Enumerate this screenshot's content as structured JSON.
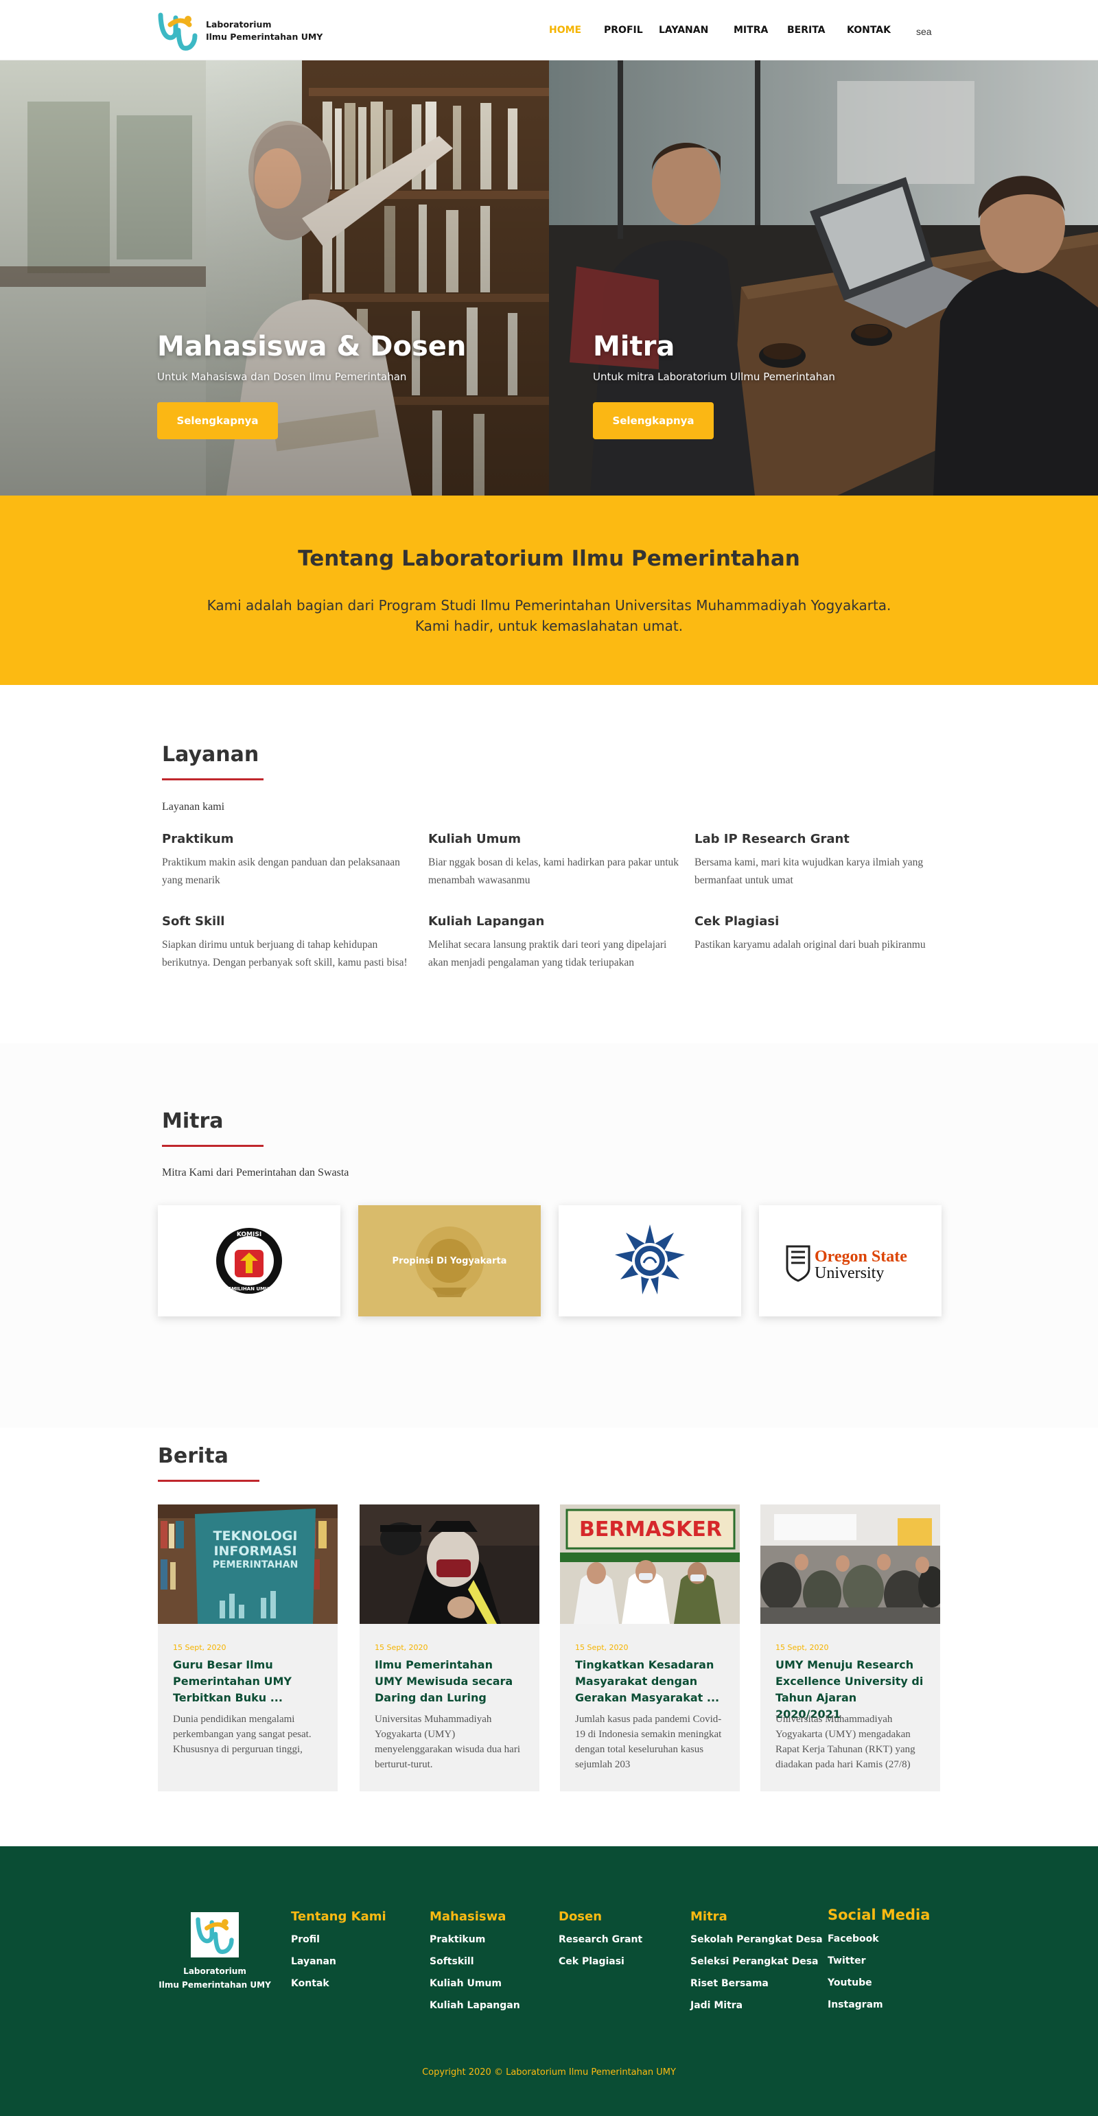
{
  "brand": {
    "name_line1": "Laboratorium",
    "name_line2": "Ilmu Pemerintahan UMY",
    "colors": {
      "primary_yellow": "#fcba12",
      "dark_green": "#0a4d34",
      "accent_red": "#c0272d",
      "teal": "#3cb8c4"
    }
  },
  "nav": {
    "items": [
      {
        "label": "HOME",
        "active": true
      },
      {
        "label": "PROFIL"
      },
      {
        "label": "LAYANAN"
      },
      {
        "label": "MITRA"
      },
      {
        "label": "BERITA"
      },
      {
        "label": "KONTAK"
      }
    ],
    "search_text": "sea"
  },
  "hero": {
    "left": {
      "title": "Mahasiswa & Dosen",
      "subtitle": "Untuk Mahasiswa dan Dosen Ilmu Pemerintahan",
      "button": "Selengkapnya"
    },
    "right": {
      "title": "Mitra",
      "subtitle": "Untuk mitra Laboratorium Ullmu Pemerintahan",
      "button": "Selengkapnya"
    }
  },
  "about": {
    "title": "Tentang Laboratorium Ilmu Pemerintahan",
    "line1": "Kami adalah bagian dari Program Studi Ilmu Pemerintahan Universitas Muhammadiyah Yogyakarta.",
    "line2": "Kami hadir, untuk kemaslahatan umat."
  },
  "layanan": {
    "title": "Layanan",
    "subtitle": "Layanan kami",
    "items": [
      {
        "title": "Praktikum",
        "desc": "Praktikum makin asik dengan panduan dan pelaksanaan yang menarik"
      },
      {
        "title": "Kuliah Umum",
        "desc": "Biar nggak bosan di kelas, kami hadirkan para pakar untuk menambah wawasanmu"
      },
      {
        "title": "Lab IP Research Grant",
        "desc": "Bersama kami, mari kita wujudkan karya ilmiah yang bermanfaat untuk umat"
      },
      {
        "title": "Soft Skill",
        "desc": "Siapkan dirimu untuk berjuang di tahap  kehidupan berikutnya. Dengan perbanyak soft skill, kamu pasti bisa!"
      },
      {
        "title": "Kuliah Lapangan",
        "desc": "Melihat secara lansung praktik dari teori yang dipelajari akan menjadi pengalaman yang tidak teriupakan"
      },
      {
        "title": "Cek Plagiasi",
        "desc": "Pastikan karyamu adalah original dari buah pikiranmu"
      }
    ]
  },
  "mitra": {
    "title": "Mitra",
    "subtitle": "Mitra Kami dari Pemerintahan dan Swasta",
    "kpu_top": "KOMISI",
    "kpu_bottom": "PEMILIHAN UMUM",
    "diy_label": "Propinsi Di Yogyakarta",
    "osu_line1": "Oregon State",
    "osu_line2": "University"
  },
  "berita": {
    "title": "Berita",
    "img_text_1": "TEKNOLOGI INFORMASI PEMERINTAHAN",
    "img_text_3": "BERMASKER",
    "items": [
      {
        "date": "15 Sept, 2020",
        "title": "Guru Besar Ilmu Pemerintahan UMY Terbitkan Buku ...",
        "excerpt": "Dunia pendidikan mengalami perkembangan yang sangat pesat. Khususnya di perguruan tinggi,"
      },
      {
        "date": "15 Sept, 2020",
        "title": "Ilmu Pemerintahan UMY Mewisuda secara Daring dan Luring",
        "excerpt": "Universitas Muhammadiyah Yogyakarta (UMY) menyelenggarakan wisuda dua hari berturut-turut."
      },
      {
        "date": "15 Sept, 2020",
        "title": "Tingkatkan Kesadaran Masyarakat dengan Gerakan Masyarakat ...",
        "excerpt": "Jumlah kasus pada pandemi Covid-19 di Indonesia semakin meningkat dengan total keseluruhan kasus sejumlah 203"
      },
      {
        "date": "15 Sept, 2020",
        "title": "UMY Menuju Research Excellence University di Tahun Ajaran 2020/2021",
        "excerpt": "Universitas Muhammadiyah Yogyakarta (UMY) mengadakan Rapat Kerja Tahunan (RKT) yang diadakan pada hari Kamis (27/8)"
      }
    ]
  },
  "footer": {
    "logo_line1": "Laboratorium",
    "logo_line2": "Ilmu Pemerintahan UMY",
    "columns": [
      {
        "title": "Tentang Kami",
        "links": [
          "Profil",
          "Layanan",
          "Kontak"
        ]
      },
      {
        "title": "Mahasiswa",
        "links": [
          "Praktikum",
          "Softskill",
          "Kuliah Umum",
          "Kuliah Lapangan"
        ]
      },
      {
        "title": "Dosen",
        "links": [
          "Research Grant",
          "Cek Plagiasi"
        ]
      },
      {
        "title": "Mitra",
        "links": [
          "Sekolah Perangkat Desa",
          "Seleksi Perangkat Desa",
          "Riset Bersama",
          "Jadi Mitra"
        ]
      },
      {
        "title": "Social Media",
        "links": [
          "Facebook",
          "Twitter",
          "Youtube",
          "Instagram"
        ]
      }
    ],
    "copyright": "Copyright 2020 © Laboratorium Ilmu Pemerintahan UMY"
  }
}
